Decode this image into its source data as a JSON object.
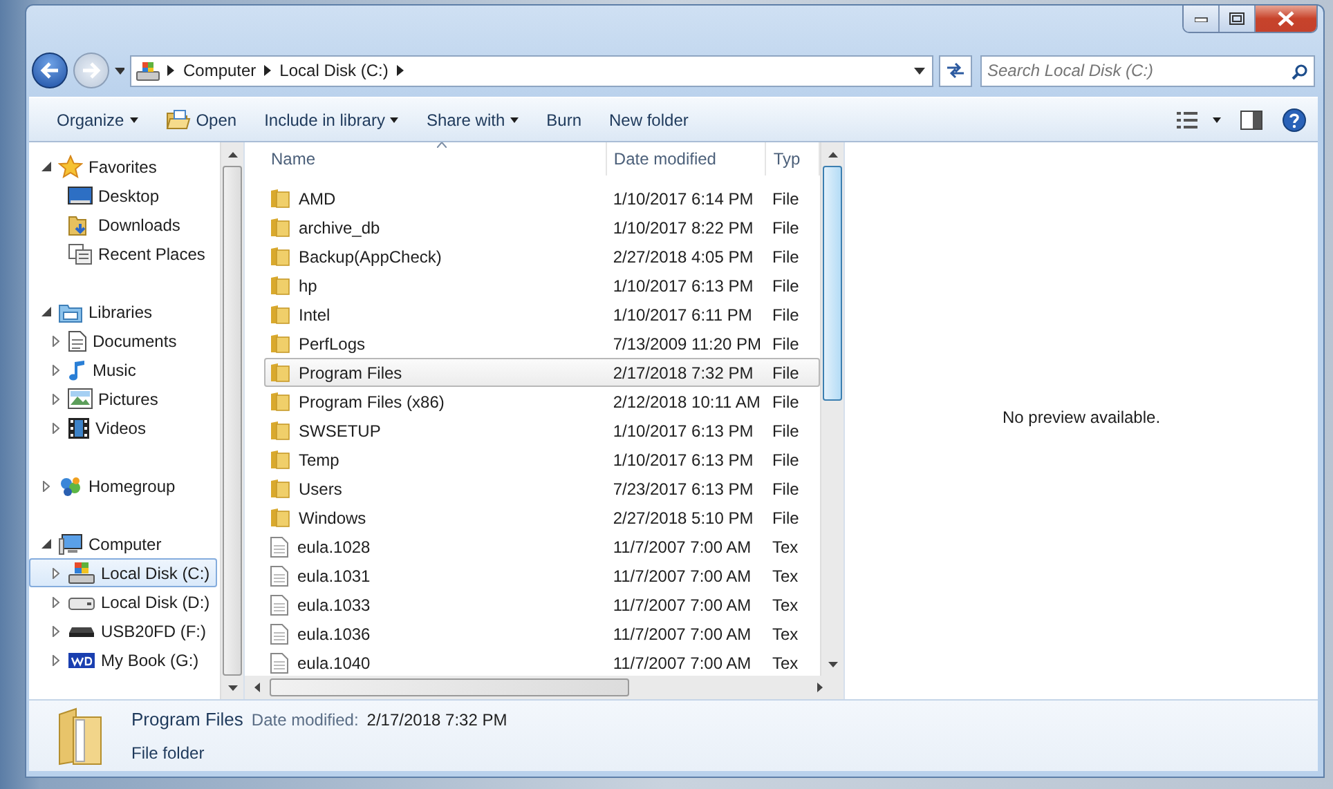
{
  "address_bar": {
    "crumbs": [
      "Computer",
      "Local Disk (C:)"
    ]
  },
  "search": {
    "placeholder": "Search Local Disk (C:)"
  },
  "toolbar": [
    {
      "label": "Organize",
      "kind": "menu"
    },
    {
      "label": "Open",
      "kind": "with_icon"
    },
    {
      "label": "Include in library",
      "kind": "menu"
    },
    {
      "label": "Share with",
      "kind": "menu"
    },
    {
      "label": "Burn",
      "kind": "plain"
    },
    {
      "label": "New folder",
      "kind": "plain"
    }
  ],
  "nav": [
    {
      "label": "Favorites",
      "expanded": true,
      "children": [
        {
          "label": "Desktop",
          "expandable": false,
          "selected": false
        },
        {
          "label": "Downloads",
          "expandable": false,
          "selected": false
        },
        {
          "label": "Recent Places",
          "expandable": false,
          "selected": false
        }
      ]
    },
    {
      "label": "Libraries",
      "expanded": true,
      "children": [
        {
          "label": "Documents",
          "expandable": true,
          "selected": false
        },
        {
          "label": "Music",
          "expandable": true,
          "selected": false
        },
        {
          "label": "Pictures",
          "expandable": true,
          "selected": false
        },
        {
          "label": "Videos",
          "expandable": true,
          "selected": false
        }
      ]
    },
    {
      "label": "Homegroup",
      "expanded": false
    },
    {
      "label": "Computer",
      "expanded": true,
      "children": [
        {
          "label": "Local Disk (C:)",
          "expandable": true,
          "selected": true
        },
        {
          "label": "Local Disk (D:)",
          "expandable": true,
          "selected": false
        },
        {
          "label": "USB20FD (F:)",
          "expandable": true,
          "selected": false
        },
        {
          "label": "My Book (G:)",
          "expandable": true,
          "selected": false
        }
      ]
    }
  ],
  "file_list": {
    "columns": [
      "Name",
      "Date modified",
      "Typ"
    ],
    "rows": [
      {
        "name": "AMD",
        "date": "1/10/2017 6:14 PM",
        "type": "File",
        "kind": "folder",
        "selected": false
      },
      {
        "name": "archive_db",
        "date": "1/10/2017 8:22 PM",
        "type": "File",
        "kind": "folder",
        "selected": false
      },
      {
        "name": "Backup(AppCheck)",
        "date": "2/27/2018 4:05 PM",
        "type": "File",
        "kind": "folder",
        "selected": false
      },
      {
        "name": "hp",
        "date": "1/10/2017 6:13 PM",
        "type": "File",
        "kind": "folder",
        "selected": false
      },
      {
        "name": "Intel",
        "date": "1/10/2017 6:11 PM",
        "type": "File",
        "kind": "folder",
        "selected": false
      },
      {
        "name": "PerfLogs",
        "date": "7/13/2009 11:20 PM",
        "type": "File",
        "kind": "folder",
        "selected": false
      },
      {
        "name": "Program Files",
        "date": "2/17/2018 7:32 PM",
        "type": "File",
        "kind": "folder",
        "selected": true
      },
      {
        "name": "Program Files (x86)",
        "date": "2/12/2018 10:11 AM",
        "type": "File",
        "kind": "folder",
        "selected": false
      },
      {
        "name": "SWSETUP",
        "date": "1/10/2017 6:13 PM",
        "type": "File",
        "kind": "folder",
        "selected": false
      },
      {
        "name": "Temp",
        "date": "1/10/2017 6:13 PM",
        "type": "File",
        "kind": "folder",
        "selected": false
      },
      {
        "name": "Users",
        "date": "7/23/2017 6:13 PM",
        "type": "File",
        "kind": "folder",
        "selected": false
      },
      {
        "name": "Windows",
        "date": "2/27/2018 5:10 PM",
        "type": "File",
        "kind": "folder",
        "selected": false
      },
      {
        "name": "eula.1028",
        "date": "11/7/2007 7:00 AM",
        "type": "Tex",
        "kind": "file",
        "selected": false
      },
      {
        "name": "eula.1031",
        "date": "11/7/2007 7:00 AM",
        "type": "Tex",
        "kind": "file",
        "selected": false
      },
      {
        "name": "eula.1033",
        "date": "11/7/2007 7:00 AM",
        "type": "Tex",
        "kind": "file",
        "selected": false
      },
      {
        "name": "eula.1036",
        "date": "11/7/2007 7:00 AM",
        "type": "Tex",
        "kind": "file",
        "selected": false
      },
      {
        "name": "eula.1040",
        "date": "11/7/2007 7:00 AM",
        "type": "Tex",
        "kind": "file",
        "selected": false
      }
    ]
  },
  "preview": {
    "message": "No preview available."
  },
  "details": {
    "name": "Program Files",
    "date_label": "Date modified:",
    "date": "2/17/2018 7:32 PM",
    "type": "File folder"
  }
}
